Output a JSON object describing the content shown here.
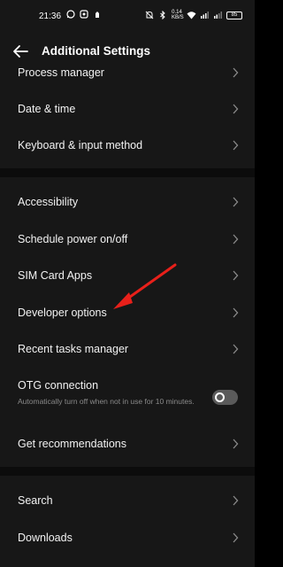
{
  "status_bar": {
    "time": "21:36",
    "network_speed": "0.14 KB/S",
    "battery": "85",
    "icons": [
      "whatsapp-icon",
      "app-icon",
      "notification-icon",
      "mute-icon",
      "bluetooth-icon",
      "wifi-icon",
      "signal-icon",
      "signal-icon"
    ]
  },
  "header": {
    "title": "Additional Settings",
    "back_icon": "arrow-left-icon"
  },
  "items": [
    {
      "label": "Process manager"
    },
    {
      "label": "Date & time"
    },
    {
      "label": "Keyboard & input method"
    },
    {
      "label": "Accessibility"
    },
    {
      "label": "Schedule power on/off"
    },
    {
      "label": "SIM Card Apps"
    },
    {
      "label": "Developer options"
    },
    {
      "label": "Recent tasks manager"
    },
    {
      "label": "Get recommendations"
    },
    {
      "label": "Search"
    },
    {
      "label": "Downloads"
    }
  ],
  "otg": {
    "title": "OTG connection",
    "description": "Automatically turn off when not in use for 10 minutes.",
    "enabled": false
  },
  "annotation": {
    "color": "#e8201a",
    "target": "Developer options"
  },
  "colors": {
    "background": "#171717",
    "text": "#f2f2f2",
    "secondary_text": "#8a8a8a",
    "chevron": "#8c8c8c",
    "toggle_off": "#5a5a5a"
  }
}
